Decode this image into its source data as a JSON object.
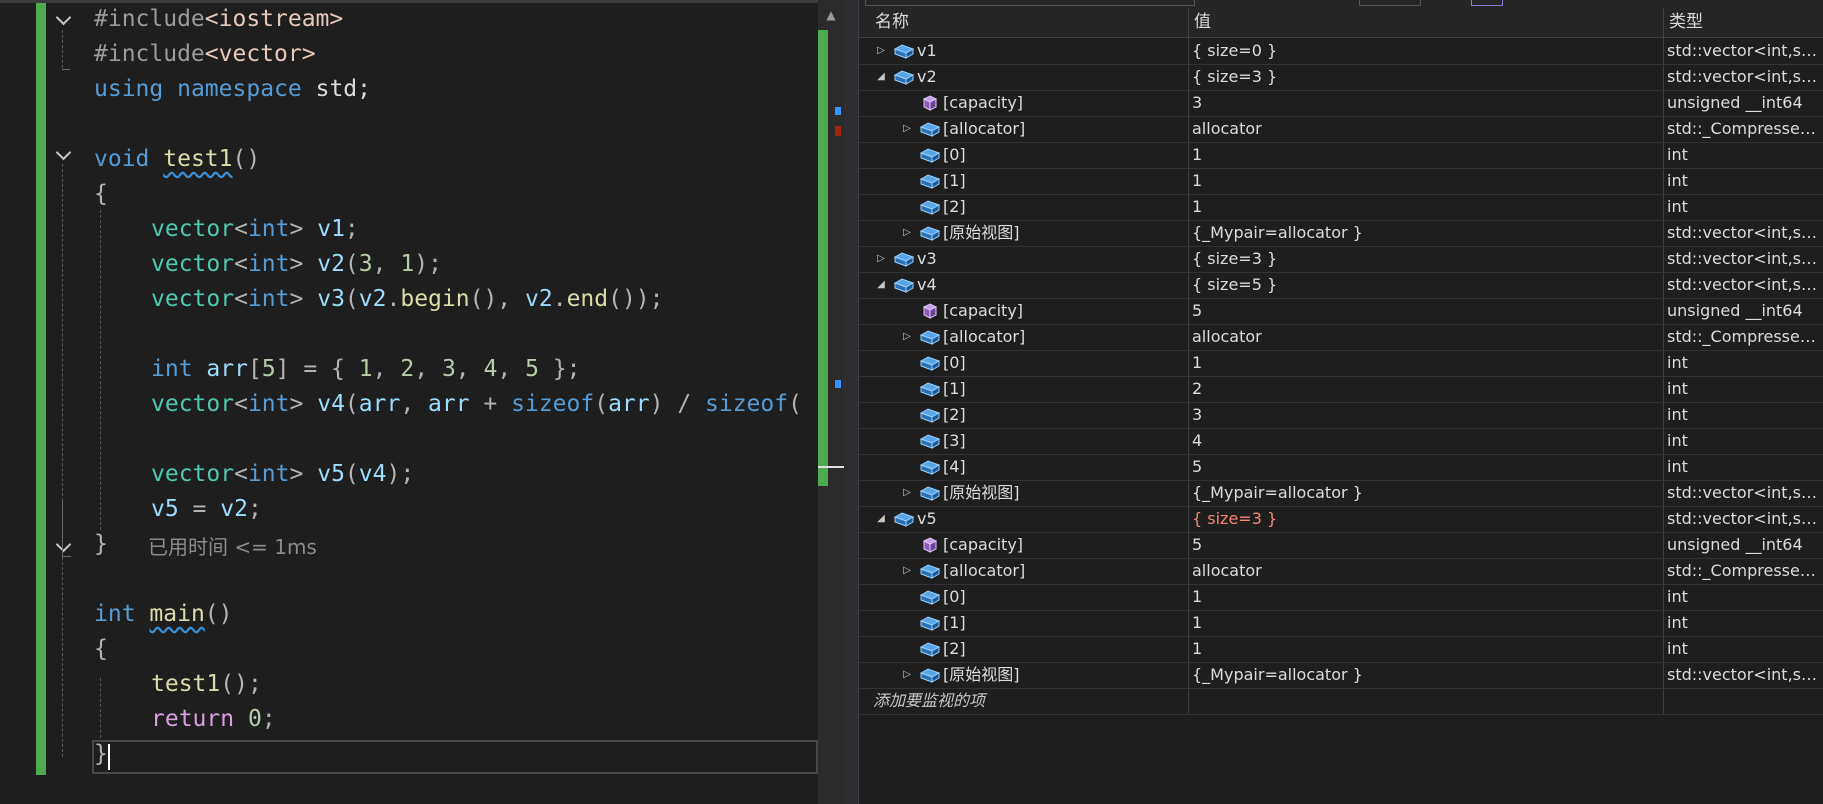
{
  "editor": {
    "lines": {
      "l1": [
        "#include",
        "<iostream>"
      ],
      "l2": [
        "#include",
        "<vector>"
      ],
      "l3": [
        "using",
        "namespace",
        "std;"
      ],
      "l5": [
        "void",
        "test1",
        "()"
      ],
      "l6": "{",
      "l7": [
        "vector",
        "<",
        "int",
        ">",
        "v1",
        ";"
      ],
      "l8": [
        "vector",
        "<",
        "int",
        ">",
        "v2",
        "(",
        "3",
        ",",
        "1",
        ");"
      ],
      "l9": [
        "vector",
        "<",
        "int",
        ">",
        "v3",
        "(",
        "v2",
        ".",
        "begin",
        "(),",
        "v2",
        ".",
        "end",
        "());"
      ],
      "l11": [
        "int",
        "arr",
        "[",
        "5",
        "] = {",
        "1",
        ",",
        "2",
        ",",
        "3",
        ",",
        "4",
        ",",
        "5",
        "};"
      ],
      "l12": [
        "vector",
        "<",
        "int",
        ">",
        "v4",
        "(",
        "arr",
        ", ",
        "arr",
        " + ",
        "sizeof",
        "(",
        "arr",
        ") / ",
        "sizeof",
        "("
      ],
      "l14": [
        "vector",
        "<",
        "int",
        ">",
        "v5",
        "(",
        "v4",
        ");"
      ],
      "l15": [
        "v5",
        " = ",
        "v2",
        ";"
      ],
      "l16": "}",
      "l18": [
        "int",
        "main",
        "()"
      ],
      "l19": "{",
      "l20": [
        "test1",
        "();"
      ],
      "l21": [
        "return",
        "0",
        ";"
      ],
      "l22": "}"
    },
    "elapsed_hint": "已用时间 <= 1ms"
  },
  "watch": {
    "headers": {
      "name": "名称",
      "value": "值",
      "type": "类型"
    },
    "rows": [
      {
        "level": 0,
        "expander": "collapsed",
        "icon": "variable",
        "name": "v1",
        "value": "{ size=0 }",
        "type": "std::vector<int,st...",
        "changed": false
      },
      {
        "level": 0,
        "expander": "expanded",
        "icon": "variable",
        "name": "v2",
        "value": "{ size=3 }",
        "type": "std::vector<int,st...",
        "changed": false
      },
      {
        "level": 1,
        "expander": "none",
        "icon": "property",
        "name": "[capacity]",
        "value": "3",
        "type": "unsigned __int64",
        "changed": false
      },
      {
        "level": 1,
        "expander": "collapsed",
        "icon": "variable",
        "name": "[allocator]",
        "value": "allocator",
        "type": "std::_Compressed...",
        "changed": false
      },
      {
        "level": 1,
        "expander": "none",
        "icon": "variable",
        "name": "[0]",
        "value": "1",
        "type": "int",
        "changed": false
      },
      {
        "level": 1,
        "expander": "none",
        "icon": "variable",
        "name": "[1]",
        "value": "1",
        "type": "int",
        "changed": false
      },
      {
        "level": 1,
        "expander": "none",
        "icon": "variable",
        "name": "[2]",
        "value": "1",
        "type": "int",
        "changed": false
      },
      {
        "level": 1,
        "expander": "collapsed",
        "icon": "variable",
        "name": "[原始视图]",
        "value": "{_Mypair=allocator }",
        "type": "std::vector<int,st...",
        "changed": false
      },
      {
        "level": 0,
        "expander": "collapsed",
        "icon": "variable",
        "name": "v3",
        "value": "{ size=3 }",
        "type": "std::vector<int,st...",
        "changed": false
      },
      {
        "level": 0,
        "expander": "expanded",
        "icon": "variable",
        "name": "v4",
        "value": "{ size=5 }",
        "type": "std::vector<int,st...",
        "changed": false
      },
      {
        "level": 1,
        "expander": "none",
        "icon": "property",
        "name": "[capacity]",
        "value": "5",
        "type": "unsigned __int64",
        "changed": false
      },
      {
        "level": 1,
        "expander": "collapsed",
        "icon": "variable",
        "name": "[allocator]",
        "value": "allocator",
        "type": "std::_Compressed...",
        "changed": false
      },
      {
        "level": 1,
        "expander": "none",
        "icon": "variable",
        "name": "[0]",
        "value": "1",
        "type": "int",
        "changed": false
      },
      {
        "level": 1,
        "expander": "none",
        "icon": "variable",
        "name": "[1]",
        "value": "2",
        "type": "int",
        "changed": false
      },
      {
        "level": 1,
        "expander": "none",
        "icon": "variable",
        "name": "[2]",
        "value": "3",
        "type": "int",
        "changed": false
      },
      {
        "level": 1,
        "expander": "none",
        "icon": "variable",
        "name": "[3]",
        "value": "4",
        "type": "int",
        "changed": false
      },
      {
        "level": 1,
        "expander": "none",
        "icon": "variable",
        "name": "[4]",
        "value": "5",
        "type": "int",
        "changed": false
      },
      {
        "level": 1,
        "expander": "collapsed",
        "icon": "variable",
        "name": "[原始视图]",
        "value": "{_Mypair=allocator }",
        "type": "std::vector<int,st...",
        "changed": false
      },
      {
        "level": 0,
        "expander": "expanded",
        "icon": "variable",
        "name": "v5",
        "value": "{ size=3 }",
        "type": "std::vector<int,st...",
        "changed": true
      },
      {
        "level": 1,
        "expander": "none",
        "icon": "property",
        "name": "[capacity]",
        "value": "5",
        "type": "unsigned __int64",
        "changed": false
      },
      {
        "level": 1,
        "expander": "collapsed",
        "icon": "variable",
        "name": "[allocator]",
        "value": "allocator",
        "type": "std::_Compressed...",
        "changed": false
      },
      {
        "level": 1,
        "expander": "none",
        "icon": "variable",
        "name": "[0]",
        "value": "1",
        "type": "int",
        "changed": false
      },
      {
        "level": 1,
        "expander": "none",
        "icon": "variable",
        "name": "[1]",
        "value": "1",
        "type": "int",
        "changed": false
      },
      {
        "level": 1,
        "expander": "none",
        "icon": "variable",
        "name": "[2]",
        "value": "1",
        "type": "int",
        "changed": false
      },
      {
        "level": 1,
        "expander": "collapsed",
        "icon": "variable",
        "name": "[原始视图]",
        "value": "{_Mypair=allocator }",
        "type": "std::vector<int,st...",
        "changed": false
      }
    ],
    "add_placeholder": "添加要监视的项"
  },
  "colors": {
    "editor_bg": "#1e1e1e",
    "change_bar": "#4eaa4e",
    "keyword": "#569cd6",
    "control_keyword": "#d8a0df",
    "type": "#4ec9b0",
    "variable": "#9cdcfe",
    "function": "#dcdcaa",
    "number": "#b5cea8",
    "changed_value": "#f48771",
    "variable_icon": "#3b8fd6",
    "property_icon": "#b180d7"
  }
}
